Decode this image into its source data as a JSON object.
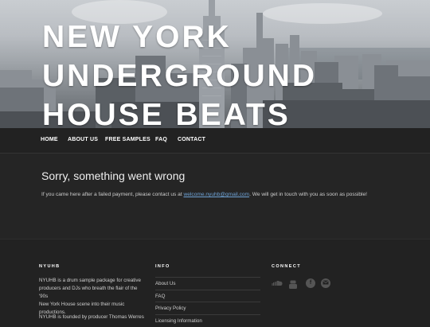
{
  "header": {
    "title_line1": "NEW YORK",
    "title_line2": "UNDERGROUND",
    "title_line3": "HOUSE BEATS"
  },
  "nav": {
    "items": [
      "HOME",
      "ABOUT US",
      "FREE SAMPLES",
      "FAQ",
      "CONTACT"
    ]
  },
  "main": {
    "error_title": "Sorry, something went wrong",
    "error_text_before": "If you came here after a failed payment, please contact us at ",
    "error_email": "welcome.nyuhb@gmail.com",
    "error_text_after": ". We will get in touch with you as soon as possible!"
  },
  "footer": {
    "nyuhb": {
      "heading": "NYUHB",
      "paragraph1_line1": "NYUHB is a drum sample package for creative",
      "paragraph1_line2": "producers and DJs who breath the flair of the '90s",
      "paragraph1_line3": "New York House scene into their music",
      "paragraph1_line4": "productions.",
      "paragraph2_line1": "NYUHB is founded by producer Thomas Werres"
    },
    "info": {
      "heading": "INFO",
      "links": [
        "About Us",
        "FAQ",
        "Privacy Policy",
        "Licensing Information"
      ]
    },
    "connect": {
      "heading": "CONNECT",
      "icons": [
        "soundcloud-icon",
        "youtube-icon",
        "facebook-icon",
        "email-icon"
      ]
    }
  },
  "colors": {
    "background": "#222222",
    "link": "#6fa3d6",
    "text": "#cccccc"
  }
}
